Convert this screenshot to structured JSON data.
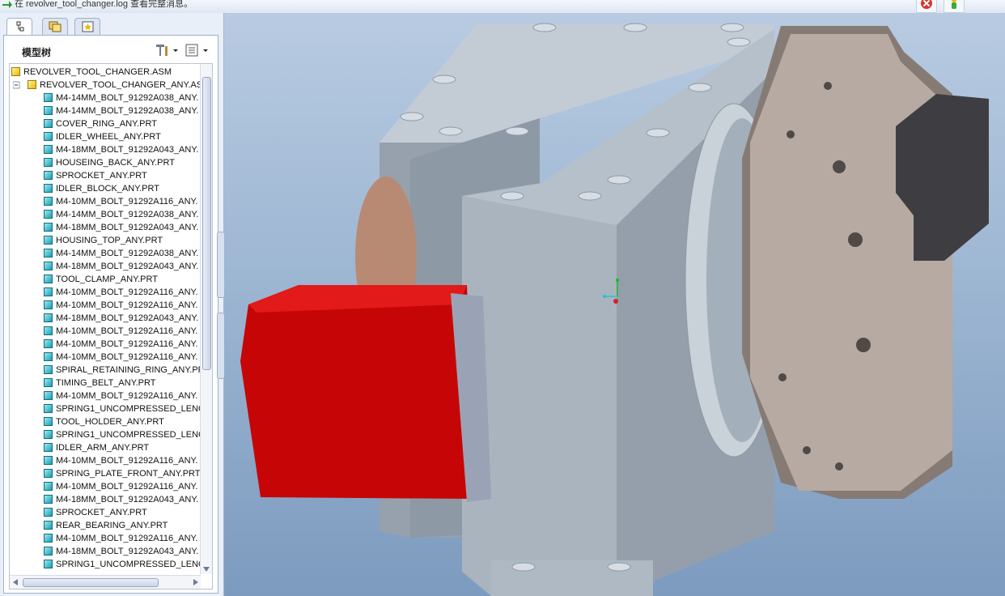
{
  "status_message": "在 revolver_tool_changer.log 查看完整消息。",
  "panel": {
    "title": "模型树",
    "tabs": [
      "model-tree-tab",
      "layers-tab",
      "favorites-tab"
    ]
  },
  "tree": {
    "root": "REVOLVER_TOOL_CHANGER.ASM",
    "subassembly": "REVOLVER_TOOL_CHANGER_ANY.ASM",
    "items": [
      "M4-14MM_BOLT_91292A038_ANY.",
      "M4-14MM_BOLT_91292A038_ANY.",
      "COVER_RING_ANY.PRT",
      "IDLER_WHEEL_ANY.PRT",
      "M4-18MM_BOLT_91292A043_ANY.",
      "HOUSEING_BACK_ANY.PRT",
      "SPROCKET_ANY.PRT",
      "IDLER_BLOCK_ANY.PRT",
      "M4-10MM_BOLT_91292A116_ANY.",
      "M4-14MM_BOLT_91292A038_ANY.",
      "M4-18MM_BOLT_91292A043_ANY.",
      "HOUSING_TOP_ANY.PRT",
      "M4-14MM_BOLT_91292A038_ANY.",
      "M4-18MM_BOLT_91292A043_ANY.",
      "TOOL_CLAMP_ANY.PRT",
      "M4-10MM_BOLT_91292A116_ANY.",
      "M4-10MM_BOLT_91292A116_ANY.",
      "M4-18MM_BOLT_91292A043_ANY.",
      "M4-10MM_BOLT_91292A116_ANY.",
      "M4-10MM_BOLT_91292A116_ANY.",
      "M4-10MM_BOLT_91292A116_ANY.",
      "SPIRAL_RETAINING_RING_ANY.PR",
      "TIMING_BELT_ANY.PRT",
      "M4-10MM_BOLT_91292A116_ANY.",
      "SPRING1_UNCOMPRESSED_LENGT",
      "TOOL_HOLDER_ANY.PRT",
      "SPRING1_UNCOMPRESSED_LENGT",
      "IDLER_ARM_ANY.PRT",
      "M4-10MM_BOLT_91292A116_ANY.",
      "SPRING_PLATE_FRONT_ANY.PRT",
      "M4-10MM_BOLT_91292A116_ANY.",
      "M4-18MM_BOLT_91292A043_ANY.",
      "SPROCKET_ANY.PRT",
      "REAR_BEARING_ANY.PRT",
      "M4-10MM_BOLT_91292A116_ANY.",
      "M4-18MM_BOLT_91292A043_ANY.",
      "SPRING1_UNCOMPRESSED_LENGT"
    ]
  },
  "colors": {
    "motor": "#c60606",
    "housing": "#a3afba",
    "turret": "#b7aaa2",
    "clamp": "#3e3e42",
    "background_top": "#b8cbe2",
    "background_bottom": "#7d9bbf"
  },
  "icons": {
    "close": "close-icon",
    "status": "status-light-icon",
    "settings": "settings-tools-icon",
    "show": "show-menu-icon"
  }
}
